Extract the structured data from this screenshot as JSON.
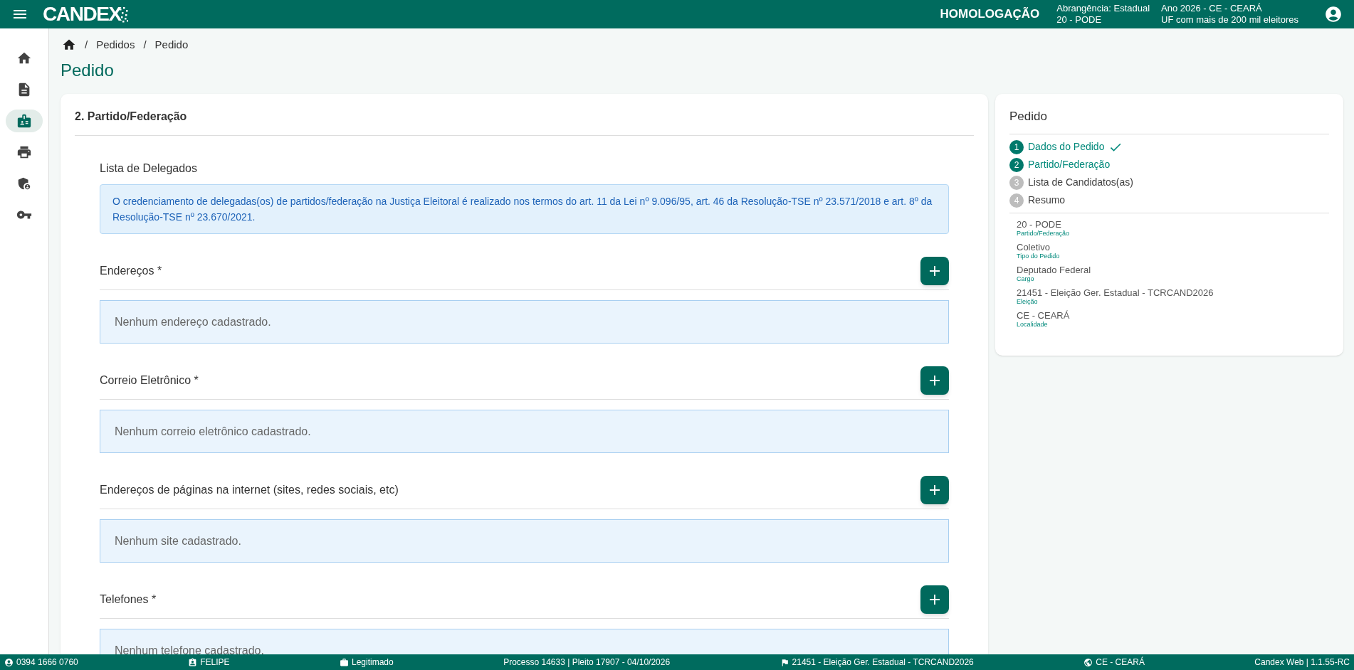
{
  "header": {
    "logo": "CANDEX",
    "environment": "HOMOLOGAÇÃO",
    "info": [
      [
        "Abrangência: Estadual",
        "20 - PODE"
      ],
      [
        "Ano 2026 - CE - CEARÁ",
        "UF com mais de 200 mil eleitores"
      ]
    ]
  },
  "sidebar": {
    "items": [
      {
        "selected": false
      },
      {
        "selected": false
      },
      {
        "selected": true
      },
      {
        "selected": false
      },
      {
        "selected": false
      },
      {
        "selected": false
      }
    ]
  },
  "breadcrumb": [
    {
      "separator": "/",
      "label": "Pedidos"
    },
    {
      "separator": "/",
      "label": "Pedido"
    }
  ],
  "page_title": "Pedido",
  "main": {
    "title": "2. Partido/Federação",
    "subtitle": "Lista de Delegados",
    "notice": "O credenciamento de delegadas(os) de partidos/federação na Justiça Eleitoral é realizado nos termos do art. 11 da Lei nº 9.096/95, art. 46 da Resolução-TSE nº 23.571/2018 e art. 8º da Resolução-TSE nº 23.670/2021.",
    "sections": [
      {
        "title": "Endereços *",
        "empty": "Nenhum endereço cadastrado."
      },
      {
        "title": "Correio Eletrônico *",
        "empty": "Nenhum correio eletrônico cadastrado."
      },
      {
        "title": "Endereços de páginas na internet (sites, redes sociais, etc)",
        "empty": "Nenhum site cadastrado."
      },
      {
        "title": "Telefones *",
        "empty": "Nenhum telefone cadastrado."
      }
    ]
  },
  "summary": {
    "title": "Pedido",
    "steps": [
      {
        "number": "1",
        "label": "Dados do Pedido",
        "reached": true,
        "checked": true
      },
      {
        "number": "2",
        "label": "Partido/Federação",
        "reached": true,
        "checked": false
      },
      {
        "number": "3",
        "label": "Lista de Candidatos(as)",
        "reached": false,
        "checked": false
      },
      {
        "number": "4",
        "label": "Resumo",
        "reached": false,
        "checked": false
      }
    ],
    "fields": [
      {
        "value": "20 - PODE",
        "label": "Partido/Federação"
      },
      {
        "value": "Coletivo",
        "label": "Tipo do Pedido"
      },
      {
        "value": "Deputado Federal",
        "label": "Cargo"
      },
      {
        "value": "21451 - Eleição Ger. Estadual - TCRCAND2026",
        "label": "Eleição"
      },
      {
        "value": "CE - CEARÁ",
        "label": "Localidade"
      }
    ]
  },
  "status_bar": [
    "0394 1666 0760",
    "FELIPE",
    "Legitimado",
    "Processo 14633 | Pleito 17907 - 04/10/2026",
    "21451 - Eleição Ger. Estadual - TCRCAND2026",
    "CE - CEARÁ",
    "Candex Web | 1.1.55-RC"
  ]
}
